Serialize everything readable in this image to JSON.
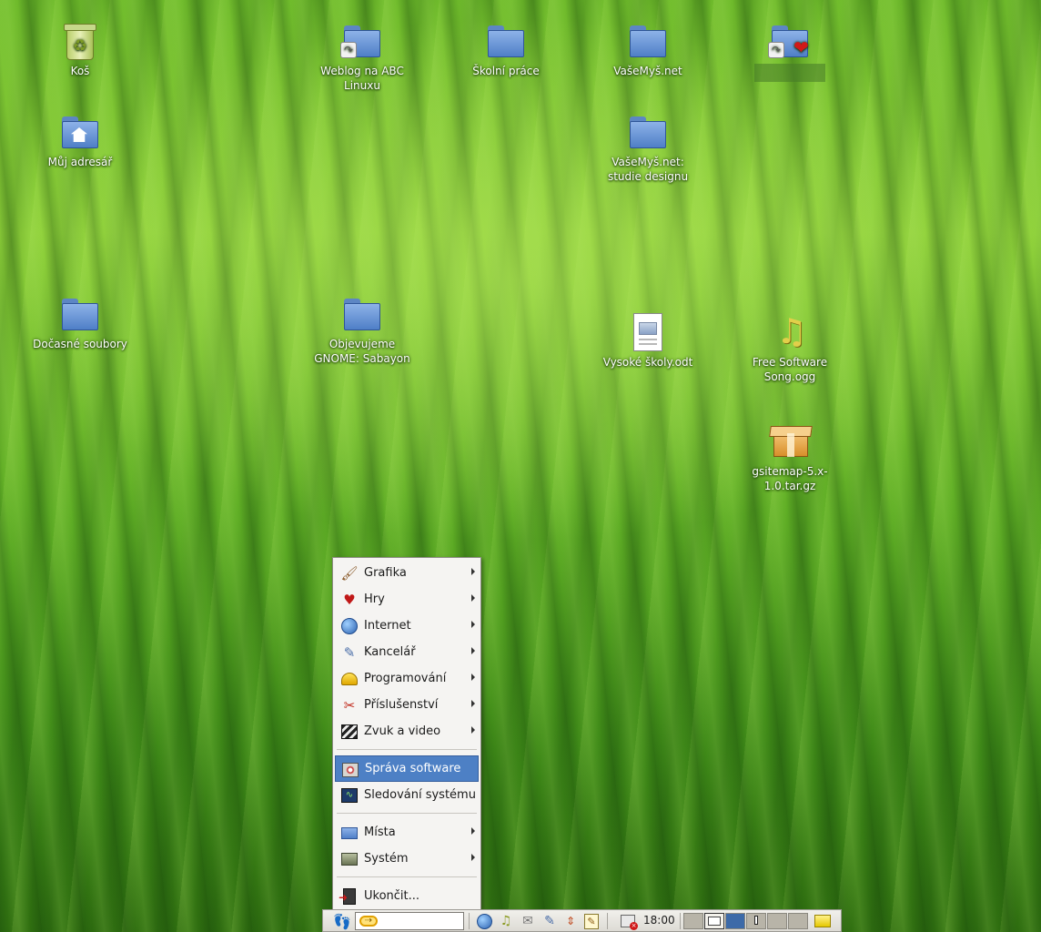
{
  "desktop": {
    "icons": {
      "trash": "Koš",
      "weblog": "Weblog na ABC Linuxu",
      "school": "Školní práce",
      "vasemys": "VašeMyš.net",
      "home": "Můj adresář",
      "vasemys_studie": "VašeMyš.net: studie designu",
      "temp": "Dočasné soubory",
      "gnome": "Objevujeme GNOME: Sabayon",
      "odt": "Vysoké školy.odt",
      "song": "Free Software Song.ogg",
      "tarball": "gsitemap-5.x-1.0.tar.gz"
    }
  },
  "menu": {
    "items": [
      {
        "label": "Grafika",
        "icon": "paintbrush-icon"
      },
      {
        "label": "Hry",
        "icon": "cards-icon"
      },
      {
        "label": "Internet",
        "icon": "globe-icon"
      },
      {
        "label": "Kancelář",
        "icon": "office-icon"
      },
      {
        "label": "Programování",
        "icon": "hardhat-icon"
      },
      {
        "label": "Příslušenství",
        "icon": "scissors-icon"
      },
      {
        "label": "Zvuk a video",
        "icon": "clapper-icon"
      },
      {
        "label": "Správa software",
        "icon": "cd-icon"
      },
      {
        "label": "Sledování systému",
        "icon": "monitor-icon"
      },
      {
        "label": "Místa",
        "icon": "folder-icon"
      },
      {
        "label": "Systém",
        "icon": "system-icon"
      },
      {
        "label": "Ukončit...",
        "icon": "exit-icon"
      }
    ]
  },
  "panel": {
    "clock": "18:00",
    "colors": {
      "active_workspace": "#3d6aa8",
      "selected_menu": "#4d80c5"
    }
  }
}
